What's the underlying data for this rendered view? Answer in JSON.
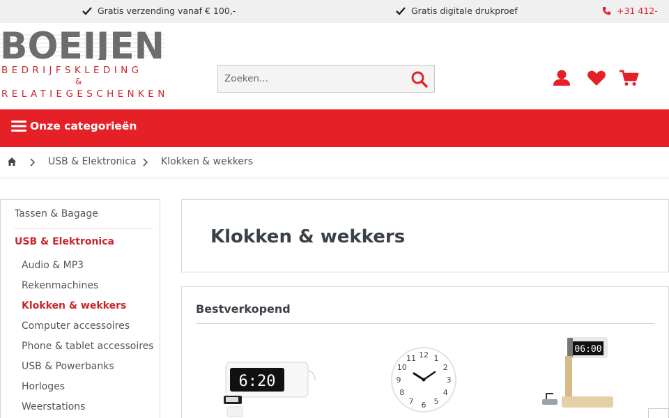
{
  "topbar": {
    "usp1": "Gratis verzending vanaf € 100,-",
    "usp2": "Gratis digitale drukproef",
    "phone": "+31 412-"
  },
  "logo": {
    "brand": "BOEIJEN",
    "line1": "BEDRIJFSKLEDING",
    "amp": "&",
    "line2": "RELATIEGESCHENKEN"
  },
  "search": {
    "placeholder": "Zoeken..."
  },
  "header_icons": [
    "account-icon",
    "wishlist-heart-icon",
    "cart-icon"
  ],
  "catbar": {
    "label": "Onze categorieën"
  },
  "breadcrumb": {
    "items": [
      "USB & Elektronica",
      "Klokken & wekkers"
    ]
  },
  "sidebar": {
    "top_item": "Tassen & Bagage",
    "active": "USB & Elektronica",
    "subitems": [
      "Audio & MP3",
      "Rekenmachines",
      "Klokken & wekkers",
      "Computer accessoires",
      "Phone & tablet accessoires",
      "USB & Powerbanks",
      "Horloges",
      "Weerstations"
    ],
    "current": "Klokken & wekkers"
  },
  "main": {
    "title": "Klokken & wekkers",
    "bestsellers": "Bestverkopend"
  },
  "products": {
    "p1_display": "6:20",
    "p2_numbers": [
      "12",
      "1",
      "2",
      "3",
      "4",
      "5",
      "6",
      "7",
      "8",
      "9",
      "10",
      "11"
    ],
    "p3_display": "06:00"
  },
  "colors": {
    "accent": "#e52127",
    "brand_red": "#c8262c",
    "text": "#3b4148"
  }
}
